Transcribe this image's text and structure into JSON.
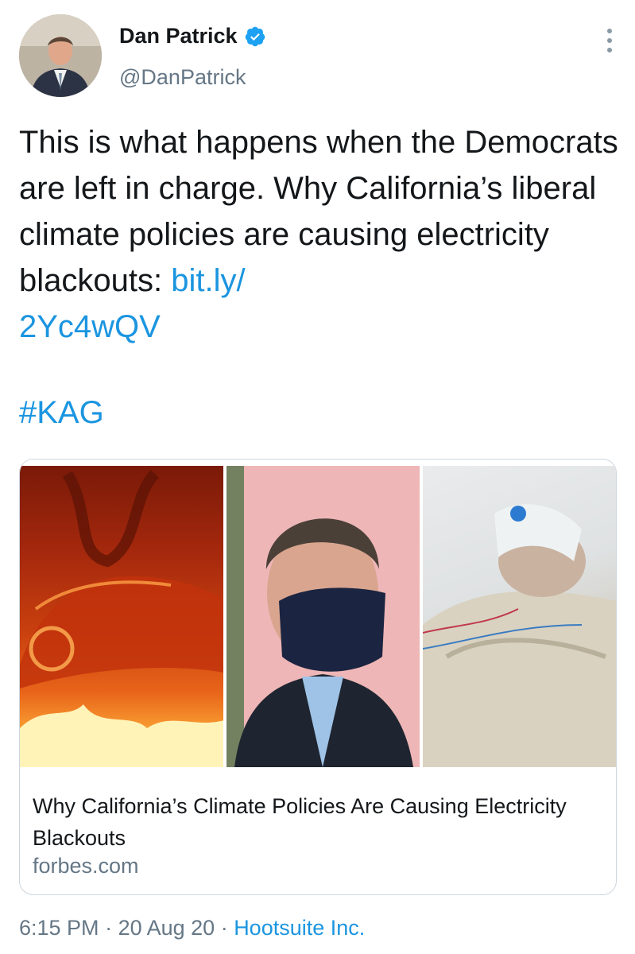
{
  "author": {
    "name": "Dan Patrick",
    "handle": "@DanPatrick",
    "verified": true,
    "avatar_icon": "profile-photo"
  },
  "tweet": {
    "text_plain": "This is what happens when the Democrats are left in charge. Why California’s liberal climate policies are causing electricity blackouts: ",
    "link_text": "bit.ly/\n2Yc4wQV",
    "hashtag": "#KAG"
  },
  "card": {
    "title": "Why California’s Climate Policies Are Causing Electricity Blackouts",
    "domain": "forbes.com"
  },
  "meta": {
    "time": "6:15 PM",
    "separator1": " · ",
    "date": "20 Aug 20",
    "separator2": " · ",
    "source": "Hootsuite Inc."
  },
  "colors": {
    "link": "#1b95e0",
    "secondary_text": "#657786",
    "verified_badge": "#1da1f2"
  }
}
